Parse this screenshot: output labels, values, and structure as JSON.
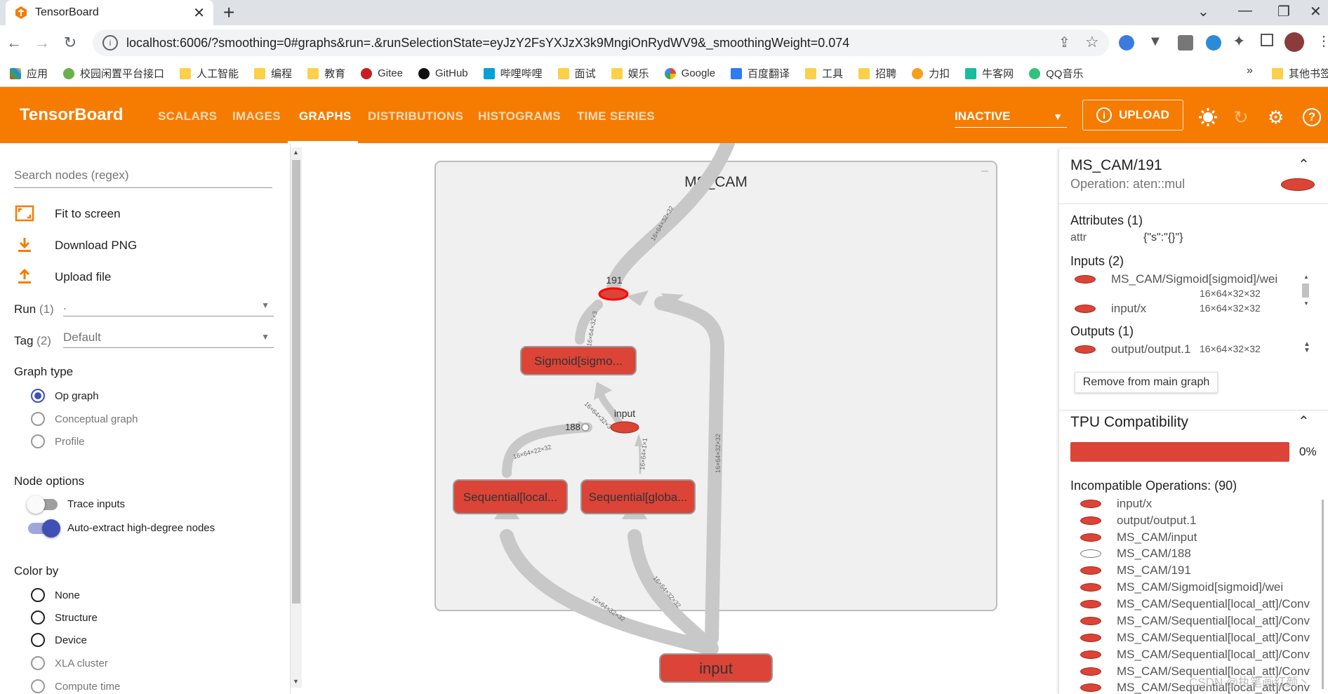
{
  "browser": {
    "tab_title": "TensorBoard",
    "url": "localhost:6006/?smoothing=0#graphs&run=.&runSelectionState=eyJzY2FsYXJzX3k9MngiOnRydWV9&_smoothingWeight=0.074",
    "bookmarks": [
      "应用",
      "校园闲置平台接口",
      "人工智能",
      "编程",
      "教育",
      "Gitee",
      "GitHub",
      "哔哩哔哩",
      "面试",
      "娱乐",
      "Google",
      "百度翻译",
      "工具",
      "招聘",
      "力扣",
      "牛客网",
      "QQ音乐"
    ],
    "more_bookmarks": "»",
    "other_bookmarks": "其他书签"
  },
  "header": {
    "brand": "TensorBoard",
    "tabs": [
      "SCALARS",
      "IMAGES",
      "GRAPHS",
      "DISTRIBUTIONS",
      "HISTOGRAMS",
      "TIME SERIES"
    ],
    "active_tab": "GRAPHS",
    "run_status": "INACTIVE",
    "upload_label": "UPLOAD",
    "accent_color": "#f57c00"
  },
  "sidebar": {
    "search_placeholder": "Search nodes (regex)",
    "actions": [
      "Fit to screen",
      "Download PNG",
      "Upload file"
    ],
    "run_label": "Run",
    "run_count": "(1)",
    "run_value": ".",
    "tag_label": "Tag",
    "tag_count": "(2)",
    "tag_value": "Default",
    "graph_type_title": "Graph type",
    "graph_types": [
      "Op graph",
      "Conceptual graph",
      "Profile"
    ],
    "node_options_title": "Node options",
    "trace_inputs": "Trace inputs",
    "auto_extract": "Auto-extract high-degree nodes",
    "color_by_title": "Color by",
    "color_by": [
      "None",
      "Structure",
      "Device",
      "XLA cluster",
      "Compute time"
    ]
  },
  "graph": {
    "group_title": "MS_CAM",
    "nodes": {
      "n191": "191",
      "sigmoid": "Sigmoid[sigmo...",
      "input_inner": "input",
      "n188": "188",
      "seq_local": "Sequential[local...",
      "seq_global": "Sequential[globa...",
      "input_outer": "input"
    },
    "edge_labels": {
      "top": "16×64×32×32",
      "sig_191": "16×64×32×3",
      "input_sig": "16×64×32×3",
      "local_188": "16×64×22×32",
      "global_input": "16×64×1×1",
      "right_long": "16×64×32×32",
      "in_local": "16×64×32×32",
      "in_global": "16×64×32×32"
    },
    "node_color": "#db4437"
  },
  "info": {
    "node_name": "MS_CAM/191",
    "operation": "Operation: aten::mul",
    "attributes_title": "Attributes (1)",
    "attr_key": "attr",
    "attr_value": "{\"s\":\"{}\"}",
    "inputs_title": "Inputs (2)",
    "inputs": [
      {
        "name": "MS_CAM/Sigmoid[sigmoid]/wei",
        "shape": "16×64×32×32"
      },
      {
        "name": "input/x",
        "shape": "16×64×32×32"
      }
    ],
    "outputs_title": "Outputs (1)",
    "outputs": [
      {
        "name": "output/output.1",
        "shape": "16×64×32×32"
      }
    ],
    "remove_label": "Remove from main graph",
    "tpu_title": "TPU Compatibility",
    "tpu_percent": "0%",
    "incompatible_title": "Incompatible Operations: (90)",
    "incompatible": [
      "input/x",
      "output/output.1",
      "MS_CAM/input",
      "MS_CAM/188",
      "MS_CAM/191",
      "MS_CAM/Sigmoid[sigmoid]/wei",
      "MS_CAM/Sequential[local_att]/Conv",
      "MS_CAM/Sequential[local_att]/Conv",
      "MS_CAM/Sequential[local_att]/Conv",
      "MS_CAM/Sequential[local_att]/Conv",
      "MS_CAM/Sequential[local_att]/Conv",
      "MS_CAM/Sequential[local_att]/Conv"
    ]
  },
  "watermark": "CSDN @执笔画红颜丶"
}
